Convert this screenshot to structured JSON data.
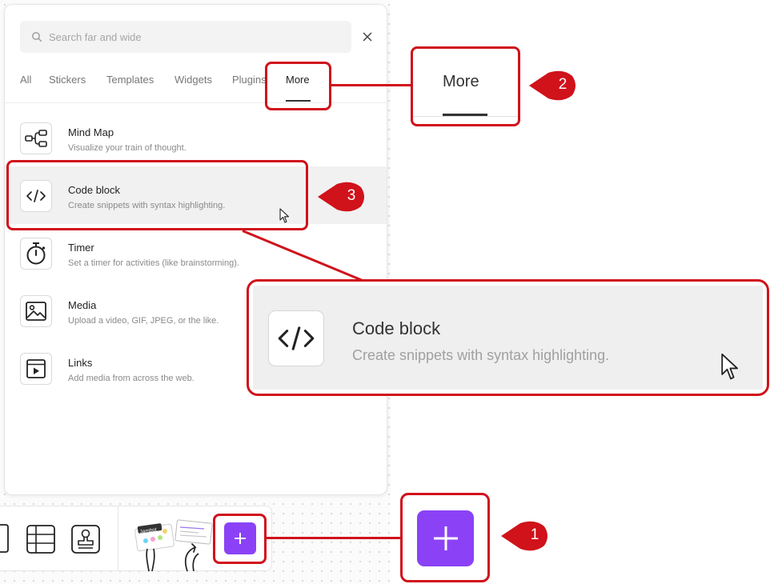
{
  "search": {
    "placeholder": "Search far and wide"
  },
  "tabs": [
    {
      "label": "All"
    },
    {
      "label": "Stickers"
    },
    {
      "label": "Templates"
    },
    {
      "label": "Widgets"
    },
    {
      "label": "Plugins"
    },
    {
      "label": "More"
    }
  ],
  "items": [
    {
      "title": "Mind Map",
      "description": "Visualize your train of thought.",
      "icon": "mind-map-icon"
    },
    {
      "title": "Code block",
      "description": "Create snippets with syntax highlighting.",
      "icon": "code-icon"
    },
    {
      "title": "Timer",
      "description": "Set a timer for activities (like brainstorming).",
      "icon": "timer-icon"
    },
    {
      "title": "Media",
      "description": "Upload a video, GIF, JPEG, or the like.",
      "icon": "image-icon"
    },
    {
      "title": "Links",
      "description": "Add media from across the web.",
      "icon": "play-window-icon"
    }
  ],
  "zoom_more": {
    "label": "More"
  },
  "zoom_code": {
    "title": "Code block",
    "description": "Create snippets with syntax highlighting."
  },
  "sticker_label": "Jambot",
  "annotations": [
    "1",
    "2",
    "3"
  ],
  "colors": {
    "accent": "#8b42f6",
    "annotation": "#d0121b"
  }
}
